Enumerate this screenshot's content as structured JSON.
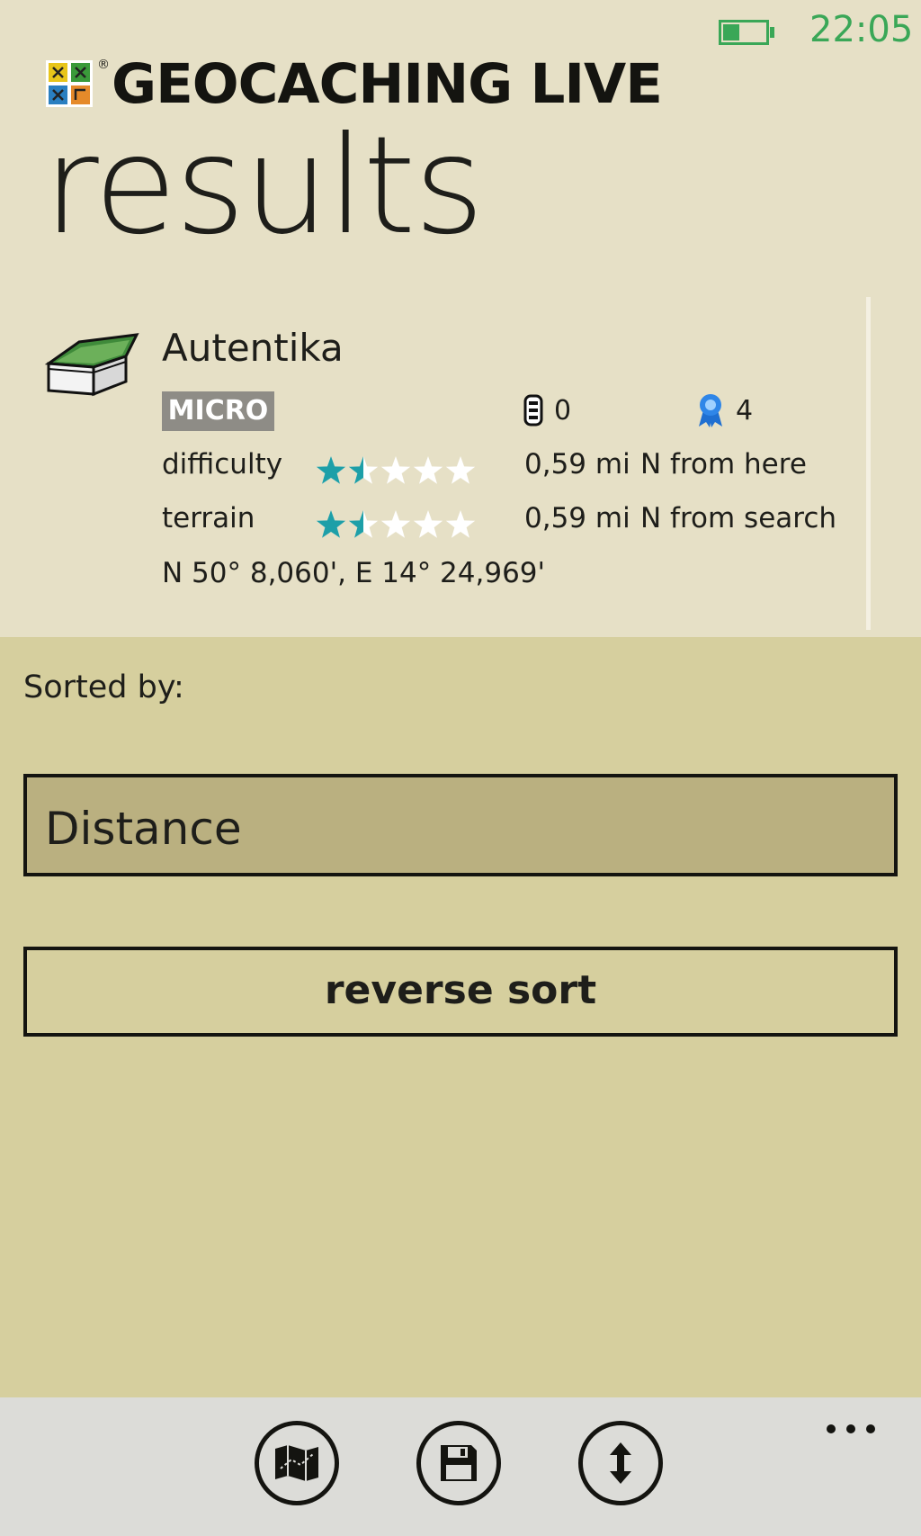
{
  "status_bar": {
    "time": "22:05",
    "battery_icon": "battery-icon"
  },
  "header": {
    "app_title": "GEOCACHING LIVE",
    "registered_mark": "®",
    "page_title": "results"
  },
  "cache": {
    "name": "Autentika",
    "size_badge": "MICRO",
    "trackables": "0",
    "favorites": "4",
    "difficulty_label": "difficulty",
    "difficulty_rating": 1.5,
    "terrain_label": "terrain",
    "terrain_rating": 1.5,
    "distance_here": "0,59 mi",
    "direction_here": "N from here",
    "distance_search": "0,59 mi",
    "direction_search": "N from search",
    "coordinates": "N 50° 8,060', E 14° 24,969'"
  },
  "sort": {
    "label": "Sorted by:",
    "selected": "Distance",
    "reverse_label": "reverse sort"
  },
  "app_bar": {
    "buttons": [
      "map-icon",
      "save-icon",
      "sort-icon"
    ],
    "more": "more-icon"
  },
  "colors": {
    "accent_green": "#3aa757",
    "star_teal": "#1d9fa8",
    "header_bg": "#e6e0c6",
    "panel_bg": "#d6cf9e",
    "select_bg": "#bab080",
    "badge_bg": "#8e8c86"
  }
}
